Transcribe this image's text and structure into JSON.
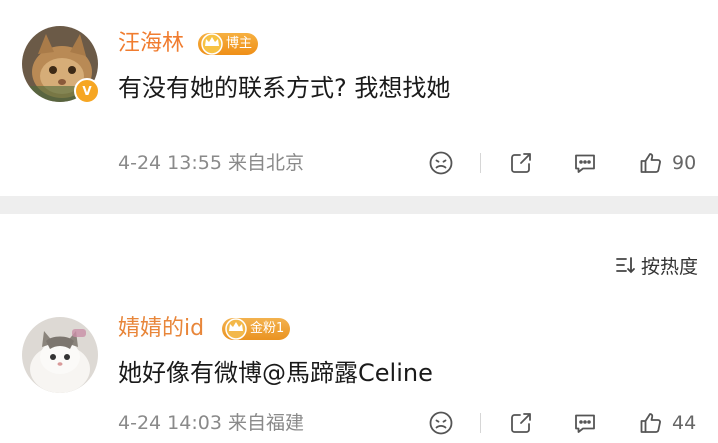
{
  "comments": [
    {
      "username": "汪海林",
      "badge": "博主",
      "verified_mark": "V",
      "text": "有没有她的联系方式? 我想找她",
      "meta": "4-24 13:55 来自北京",
      "likes": "90"
    },
    {
      "username": "婧婧的id",
      "badge": "金粉1",
      "text": "她好像有微博@馬蹄露Celine",
      "meta": "4-24 14:03 来自福建",
      "likes": "44"
    }
  ],
  "sort": {
    "label": "按热度"
  },
  "colors": {
    "username_orange": "#f07c2f",
    "badge_gold": "#ef8f17",
    "meta_gray": "#8a8a8a",
    "divider": "#eeeeee"
  },
  "icons": [
    "emoji-reaction-icon",
    "share-icon",
    "comment-icon",
    "like-icon",
    "sort-icon",
    "crown-icon",
    "verified-badge-icon"
  ]
}
